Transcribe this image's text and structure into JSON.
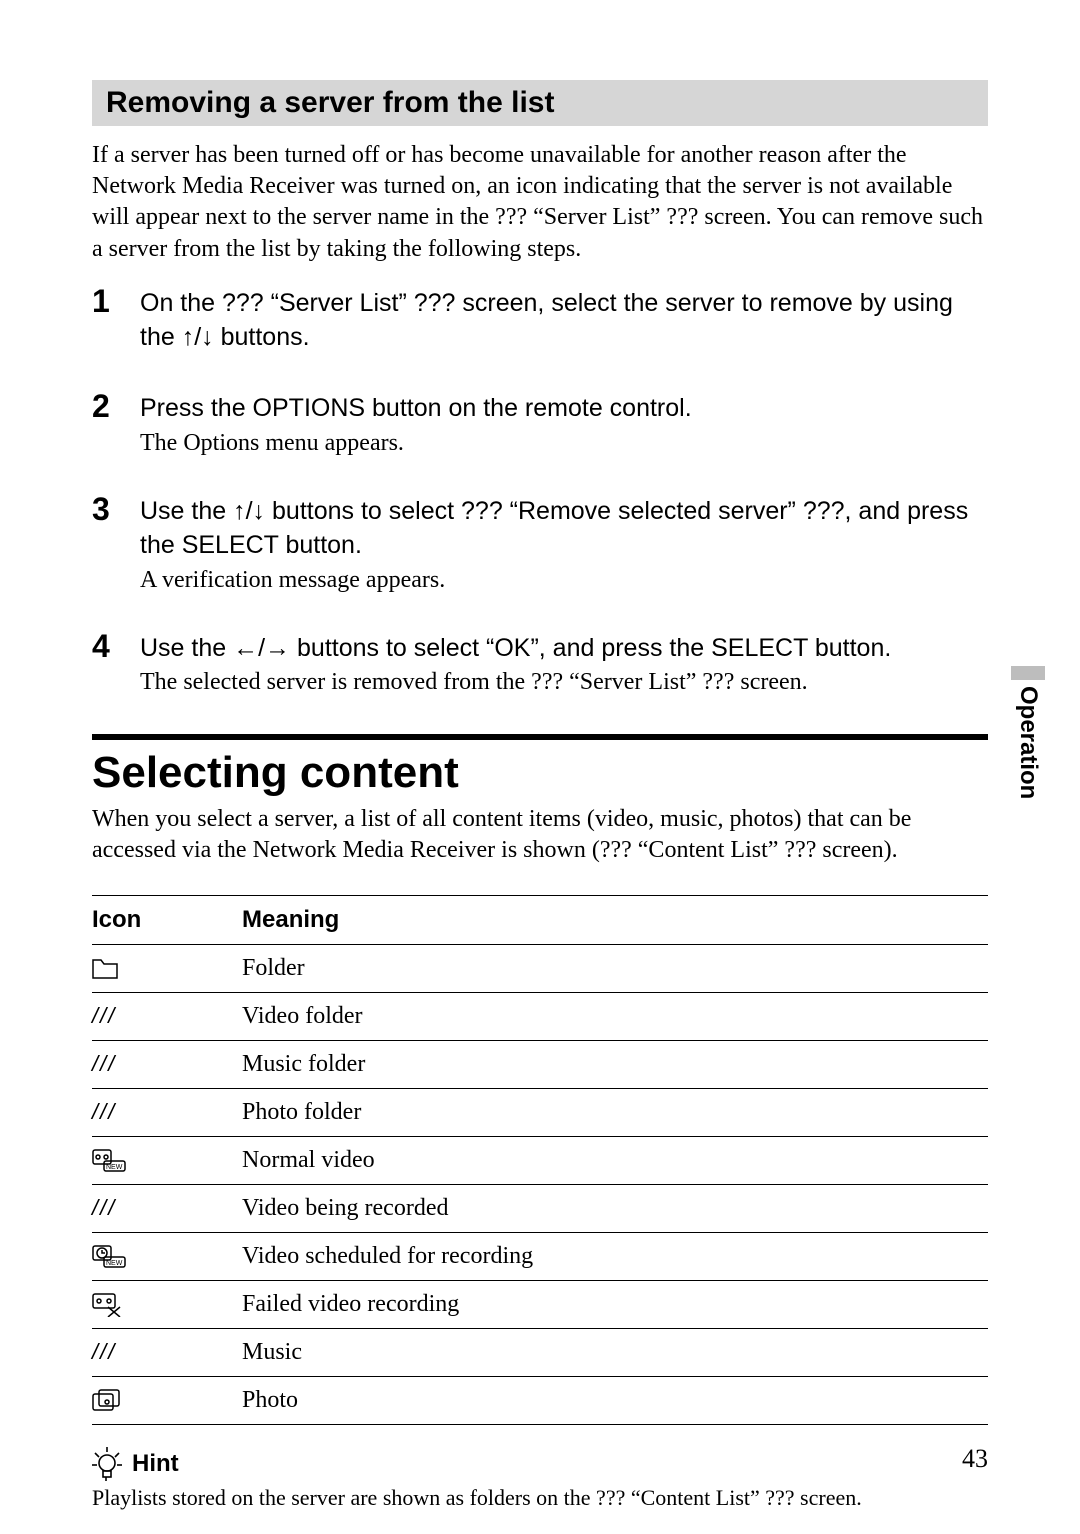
{
  "section1": {
    "title": "Removing a server from the list",
    "intro": "If a server has been turned off or has become unavailable for another reason after the Network Media Receiver was turned on, an icon indicating that the server is not available will appear next to the server name in the ??? “Server List” ??? screen. You can remove such a server from the list by taking the following steps.",
    "steps": [
      {
        "num": "1",
        "main_a": "On the ??? “Server List” ??? screen, select the server to remove by using the ",
        "main_b": " buttons.",
        "arrows": "↑/↓",
        "sub": ""
      },
      {
        "num": "2",
        "main_a": "Press the OPTIONS button on the remote control.",
        "main_b": "",
        "arrows": "",
        "sub": "The Options menu appears."
      },
      {
        "num": "3",
        "main_a": "Use the ",
        "main_b": "  buttons to select ??? “Remove selected server” ???, and press the SELECT button.",
        "arrows": "↑/↓",
        "sub": "A verification message appears."
      },
      {
        "num": "4",
        "main_a": "Use the ",
        "main_b": " buttons to select “OK”, and press the SELECT button.",
        "arrows": "←/→",
        "sub": "The selected server is removed from the ??? “Server List” ??? screen."
      }
    ]
  },
  "section2": {
    "title": "Selecting content",
    "intro": "When you select a server, a list of all content items (video, music, photos) that can be accessed via the Network Media Receiver is shown (??? “Content List” ??? screen).",
    "table": {
      "header_icon": "Icon",
      "header_meaning": "Meaning",
      "rows": [
        {
          "icon": "folder",
          "meaning": "Folder"
        },
        {
          "icon": "slashes",
          "meaning": "Video folder"
        },
        {
          "icon": "slashes",
          "meaning": "Music folder"
        },
        {
          "icon": "slashes",
          "meaning": "Photo folder"
        },
        {
          "icon": "tape_new",
          "meaning": "Normal video"
        },
        {
          "icon": "slashes",
          "meaning": "Video being recorded"
        },
        {
          "icon": "clock_new",
          "meaning": "Video scheduled for recording"
        },
        {
          "icon": "tape_x",
          "meaning": "Failed video recording"
        },
        {
          "icon": "slashes",
          "meaning": "Music"
        },
        {
          "icon": "photos",
          "meaning": "Photo"
        }
      ]
    },
    "hint_label": "Hint",
    "hint_body": "Playlists stored on the server are shown as folders on the ??? “Content List” ??? screen."
  },
  "side_tab": "Operation",
  "page_number": "43"
}
